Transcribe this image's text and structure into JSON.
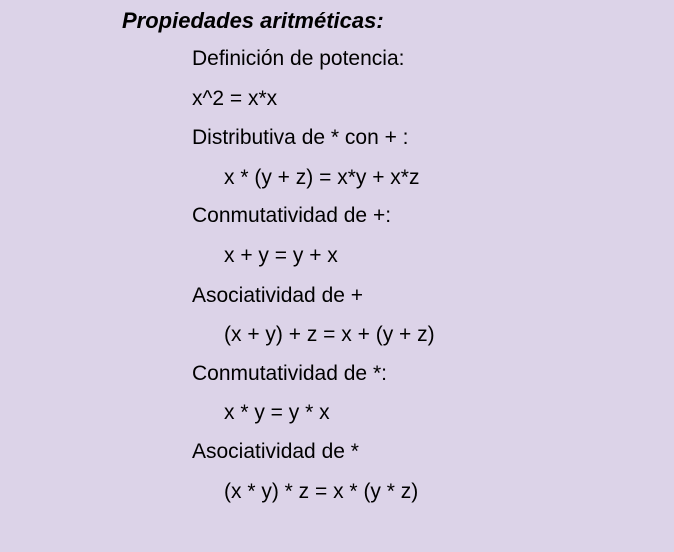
{
  "title": "Propiedades aritméticas:",
  "items": [
    {
      "text": "Definición de potencia:",
      "level": 1
    },
    {
      "text": "x^2 = x*x",
      "level": 1
    },
    {
      "text": "Distributiva de * con + :",
      "level": 1
    },
    {
      "text": "x * (y + z) = x*y + x*z",
      "level": 2
    },
    {
      "text": "Conmutatividad de +:",
      "level": 1
    },
    {
      "text": "x + y = y + x",
      "level": 2
    },
    {
      "text": "Asociatividad de +",
      "level": 1
    },
    {
      "text": "(x + y) + z = x + (y + z)",
      "level": 2
    },
    {
      "text": "Conmutatividad de *:",
      "level": 1
    },
    {
      "text": "x * y = y * x",
      "level": 2
    },
    {
      "text": "Asociatividad de *",
      "level": 1
    },
    {
      "text": "(x * y) * z = x * (y * z)",
      "level": 2
    }
  ],
  "colors": {
    "background": "#dcd3e8",
    "text": "#000000"
  }
}
